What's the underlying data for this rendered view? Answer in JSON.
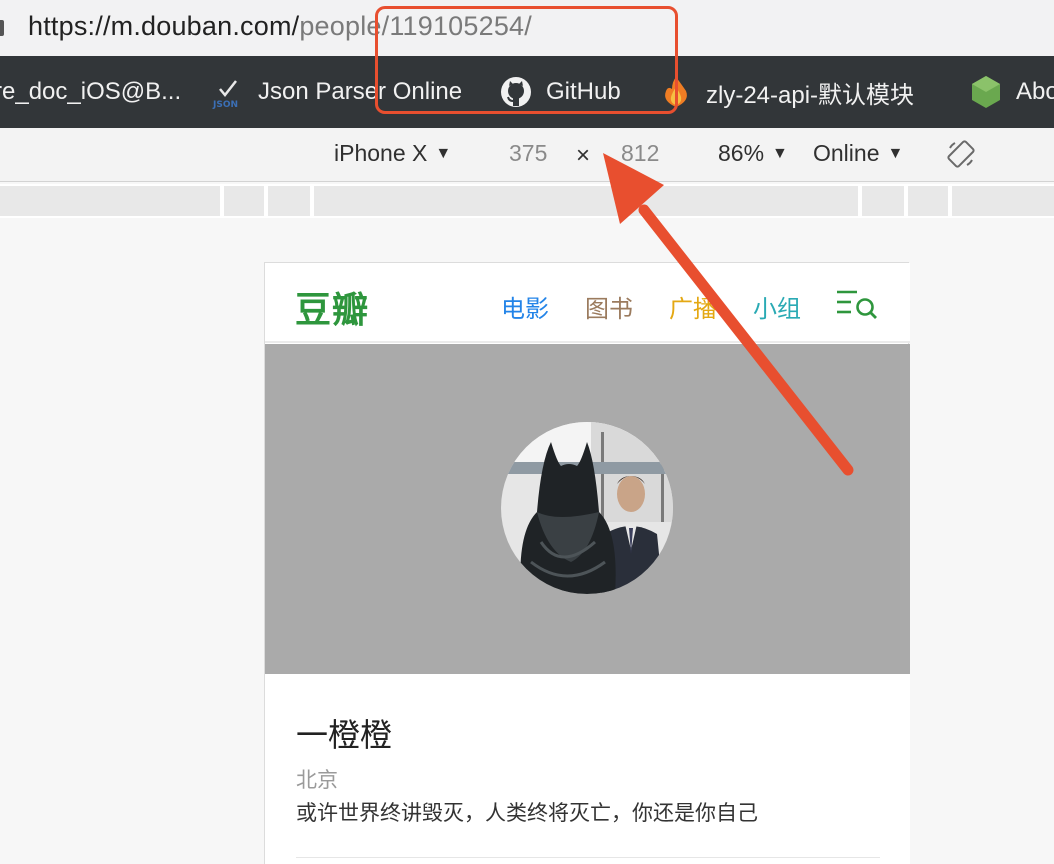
{
  "browser": {
    "url": {
      "host": "https://m.douban.com/",
      "path": "people/119105254/"
    },
    "bookmarks": [
      {
        "label": "re_doc_iOS@B...",
        "icon": "doc-icon"
      },
      {
        "label": "Json Parser Online",
        "icon": "json-icon"
      },
      {
        "label": "GitHub",
        "icon": "github-icon"
      },
      {
        "label": "zly-24-api-默认模块",
        "icon": "flame-icon"
      },
      {
        "label": "Abo",
        "icon": "node-icon"
      }
    ]
  },
  "devtools": {
    "device": "iPhone X",
    "width": "375",
    "times": "×",
    "height": "812",
    "zoom": "86%",
    "network": "Online"
  },
  "mobile_page": {
    "logo": "豆瓣",
    "nav": [
      "电影",
      "图书",
      "广播",
      "小组"
    ],
    "profile": {
      "name": "一橙橙",
      "location": "北京",
      "bio": "或许世界终讲毁灭，人类终将灭亡，你还是你自己"
    }
  },
  "colors": {
    "annotation": "#e84f2f",
    "douban_green": "#2e963d",
    "nav_movie": "#2384e8",
    "nav_book": "#9b7b5e",
    "nav_radio": "#e4a813",
    "nav_group": "#2aaab4",
    "cover_bg": "#aaaaaa"
  }
}
